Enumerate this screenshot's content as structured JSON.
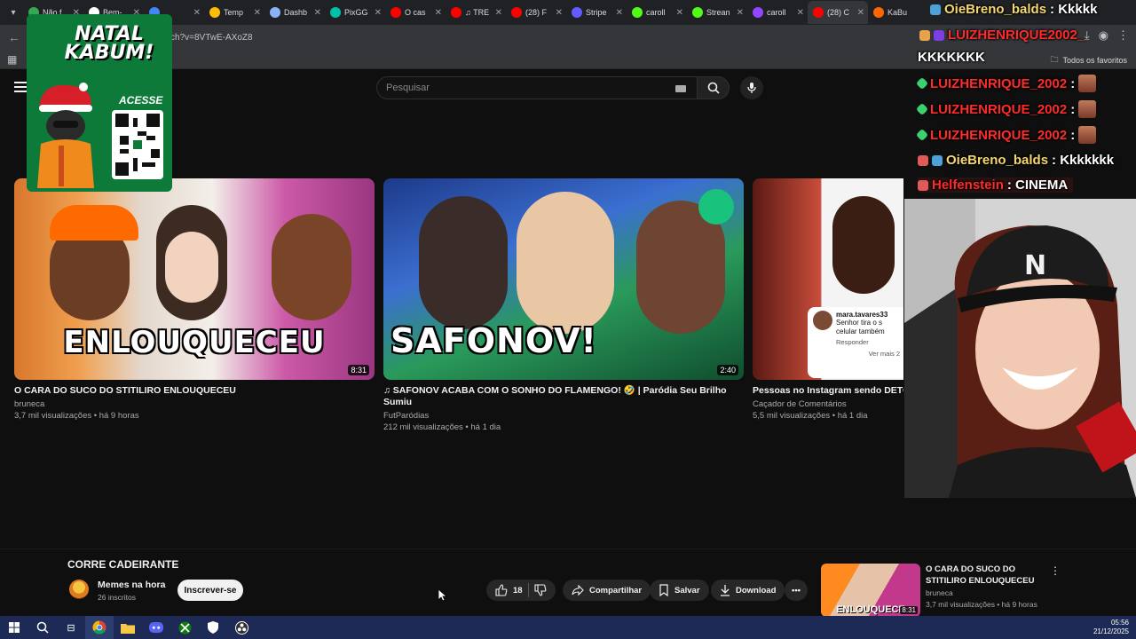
{
  "browser": {
    "tabs": [
      {
        "title": "Não f",
        "color": "#34a853"
      },
      {
        "title": "Bem-",
        "color": "#ffffff"
      },
      {
        "title": "",
        "color": "#4285f4"
      },
      {
        "title": "Temp",
        "color": "#fbbc04"
      },
      {
        "title": "Dashb",
        "color": "#8ab4f8"
      },
      {
        "title": "PixGG",
        "color": "#00c2a8"
      },
      {
        "title": "O cas",
        "color": "#ff0000"
      },
      {
        "title": "♫ TRE",
        "color": "#ff0000"
      },
      {
        "title": "(28) F",
        "color": "#ff0000"
      },
      {
        "title": "Stripe",
        "color": "#635bff"
      },
      {
        "title": "caroll",
        "color": "#53fc18"
      },
      {
        "title": "Strean",
        "color": "#53fc18"
      },
      {
        "title": "caroll",
        "color": "#9146ff"
      },
      {
        "title": "(28) C",
        "color": "#ff0000",
        "active": true
      },
      {
        "title": "KaBu",
        "color": "#ff6500"
      }
    ],
    "url": "ch?v=8VTwE-AXoZ8",
    "favorites_label": "Todos os favoritos"
  },
  "youtube": {
    "search_placeholder": "Pesquisar",
    "videos": [
      {
        "thumb_text": "ENLOUQUECEU",
        "duration": "8:31",
        "title": "O CARA DO SUCO DO STITILIRO ENLOUQUECEU",
        "channel": "bruneca",
        "meta": "3,7 mil visualizações • há 9 horas"
      },
      {
        "thumb_text": "SAFONOV!",
        "duration": "2:40",
        "title": "♫ SAFONOV ACABA COM O SONHO DO FLAMENGO! 🤣 | Paródia Seu Brilho Sumiu",
        "channel": "FutParódias",
        "meta": "212 mil visualizações • há 1 dia"
      },
      {
        "thumb_text": "",
        "duration": "",
        "title": "Pessoas no Instagram sendo DETO",
        "channel": "Caçador de Comentários",
        "meta": "5,5 mil visualizações • há 1 dia",
        "comment_user": "mara.tavares33",
        "comment_text": "Senhor tira o s celular também",
        "comment_reply": "Responder",
        "comment_more": "Ver mais 2"
      }
    ],
    "now_playing": {
      "title": "CORRE CADEIRANTE",
      "channel": "Memes na hora",
      "subs": "26 inscritos",
      "subscribe_label": "Inscrever-se",
      "likes": "18",
      "share_label": "Compartilhar",
      "save_label": "Salvar",
      "download_label": "Download"
    },
    "up_next": {
      "title": "O CARA DO SUCO DO STITILIRO ENLOUQUECEU",
      "channel": "bruneca",
      "meta": "3,7 mil visualizações • há 9 horas",
      "duration": "8:31",
      "thumb_text": "ENLOUQUECE"
    }
  },
  "overlay": {
    "promo_title": "NATAL KABUM!",
    "promo_cta": "ACESSE",
    "chat": [
      {
        "user": "OieBreno_balds",
        "msg": ": Kkkkk",
        "color": "#f5d76e"
      },
      {
        "user": "LUIZHENRIQUE2002_",
        "msg": "",
        "color": "#ff2b2b"
      },
      {
        "user": "",
        "msg": "KKKKKKK",
        "color": "#ffffff"
      },
      {
        "user": "LUIZHENRIQUE_2002",
        "msg": ":",
        "color": "#ff2b2b"
      },
      {
        "user": "LUIZHENRIQUE_2002",
        "msg": ":",
        "color": "#ff2b2b"
      },
      {
        "user": "LUIZHENRIQUE_2002",
        "msg": ":",
        "color": "#ff2b2b"
      },
      {
        "user": "OieBreno_balds",
        "msg": ": Kkkkkkk",
        "color": "#f5d76e"
      },
      {
        "user": "Helfenstein",
        "msg": ": CINEMA",
        "color": "#ff2b2b"
      }
    ]
  },
  "taskbar": {
    "time": "05:56",
    "date": "21/12/2025"
  }
}
